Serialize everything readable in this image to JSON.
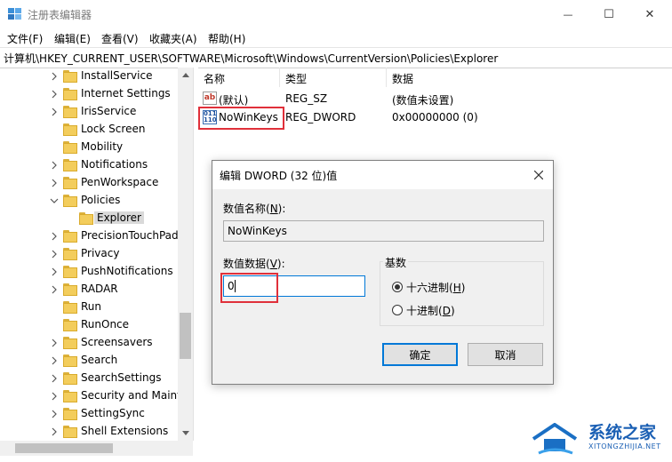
{
  "window": {
    "title": "注册表编辑器",
    "minimize_glyph": "—",
    "maximize_glyph": "☐",
    "close_glyph": "✕"
  },
  "menu": [
    "文件(F)",
    "编辑(E)",
    "查看(V)",
    "收藏夹(A)",
    "帮助(H)"
  ],
  "address": "计算机\\HKEY_CURRENT_USER\\SOFTWARE\\Microsoft\\Windows\\CurrentVersion\\Policies\\Explorer",
  "tree": {
    "items": [
      {
        "label": "InstallService",
        "expand": "collapsed"
      },
      {
        "label": "Internet Settings",
        "expand": "collapsed"
      },
      {
        "label": "IrisService",
        "expand": "collapsed"
      },
      {
        "label": "Lock Screen",
        "expand": "none"
      },
      {
        "label": "Mobility",
        "expand": "none"
      },
      {
        "label": "Notifications",
        "expand": "collapsed"
      },
      {
        "label": "PenWorkspace",
        "expand": "collapsed"
      },
      {
        "label": "Policies",
        "expand": "expanded"
      },
      {
        "label": "Explorer",
        "expand": "none",
        "selected": true
      },
      {
        "label": "PrecisionTouchPad",
        "expand": "collapsed"
      },
      {
        "label": "Privacy",
        "expand": "collapsed"
      },
      {
        "label": "PushNotifications",
        "expand": "collapsed"
      },
      {
        "label": "RADAR",
        "expand": "collapsed"
      },
      {
        "label": "Run",
        "expand": "none"
      },
      {
        "label": "RunOnce",
        "expand": "none"
      },
      {
        "label": "Screensavers",
        "expand": "collapsed"
      },
      {
        "label": "Search",
        "expand": "collapsed"
      },
      {
        "label": "SearchSettings",
        "expand": "collapsed"
      },
      {
        "label": "Security and Maint",
        "expand": "collapsed"
      },
      {
        "label": "SettingSync",
        "expand": "collapsed"
      },
      {
        "label": "Shell Extensions",
        "expand": "collapsed"
      }
    ]
  },
  "values": {
    "columns": [
      "名称",
      "类型",
      "数据"
    ],
    "rows": [
      {
        "name": "(默认)",
        "type": "REG_SZ",
        "data": "(数值未设置)",
        "icon": "ab-icon"
      },
      {
        "name": "NoWinKeys",
        "type": "REG_DWORD",
        "data": "0x00000000 (0)",
        "icon": "binary-icon"
      }
    ]
  },
  "dialog": {
    "title": "编辑 DWORD (32 位)值",
    "value_name_label": "数值名称(",
    "value_name_key": "N",
    "value_name_suffix": "):",
    "value_name": "NoWinKeys",
    "value_data_label": "数值数据(",
    "value_data_key": "V",
    "value_data_suffix": "):",
    "value_data": "0",
    "base_label": "基数",
    "hex_label": "十六进制(",
    "hex_key": "H",
    "dec_label": "十进制(",
    "dec_key": "D",
    "suffix": ")",
    "ok": "确定",
    "cancel": "取消"
  },
  "watermark": {
    "title": "系统之家",
    "subtitle": "XITONGZHIJIA.NET"
  },
  "colors": {
    "highlight_red": "#e0303a",
    "accent": "#0078d7",
    "folder": "#f3cd5c"
  }
}
